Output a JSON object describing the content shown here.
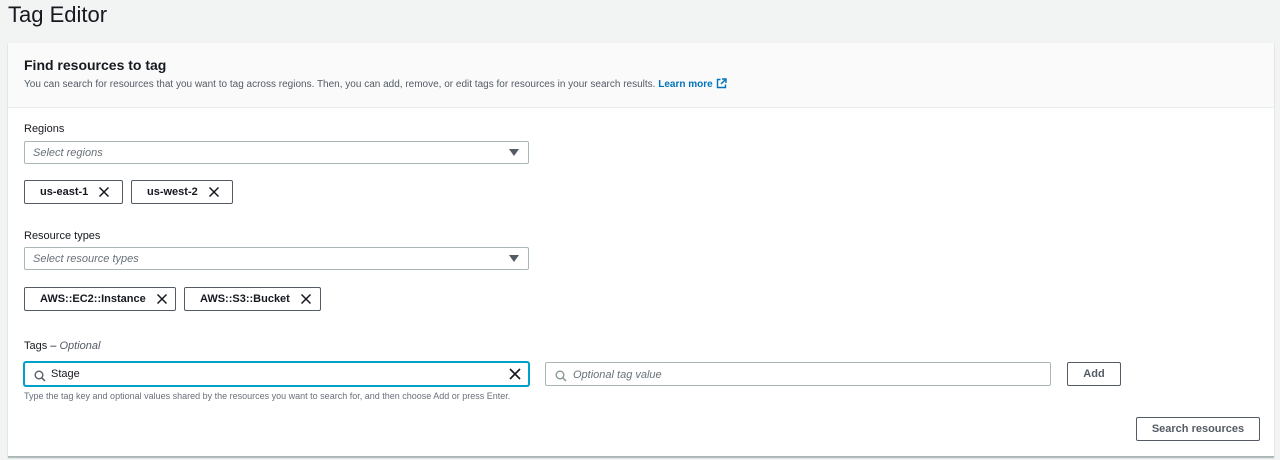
{
  "page": {
    "title": "Tag Editor"
  },
  "panel": {
    "title": "Find resources to tag",
    "description": "You can search for resources that you want to tag across regions. Then, you can add, remove, or edit tags for resources in your search results.",
    "learn_more": "Learn more"
  },
  "regions": {
    "label": "Regions",
    "placeholder": "Select regions",
    "selected": [
      "us-east-1",
      "us-west-2"
    ]
  },
  "resource_types": {
    "label": "Resource types",
    "placeholder": "Select resource types",
    "selected": [
      "AWS::EC2::Instance",
      "AWS::S3::Bucket"
    ]
  },
  "tags": {
    "label": "Tags –",
    "label_optional": "Optional",
    "key_value": "Stage",
    "value_placeholder": "Optional tag value",
    "add_label": "Add",
    "hint": "Type the tag key and optional values shared by the resources you want to search for, and then choose Add or press Enter."
  },
  "actions": {
    "search_label": "Search resources"
  },
  "colors": {
    "link": "#0073bb",
    "focus": "#00a1c9",
    "border": "#aab7b8",
    "background": "#f2f3f3"
  },
  "icons": [
    "external-link-icon",
    "caret-down-icon",
    "close-icon",
    "search-icon",
    "clear-icon"
  ]
}
